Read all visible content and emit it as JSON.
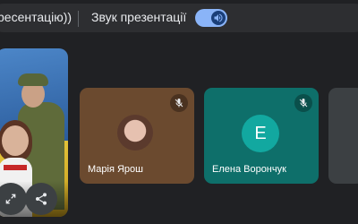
{
  "topbar": {
    "presentation_tab_label": "ресентацію))",
    "presentation_sound_label": "Звук презентації",
    "sound_toggle_state": "on"
  },
  "presentation": {
    "expand_icon": "expand-icon",
    "share_icon": "share-icon"
  },
  "participants": [
    {
      "name": "Марія Ярош",
      "mic": "muted",
      "avatar_type": "photo",
      "tile_color": "#6b4a2f"
    },
    {
      "name": "Елена Ворончук",
      "mic": "muted",
      "avatar_type": "letter",
      "avatar_letter": "Е",
      "tile_color": "#0e6f6a"
    }
  ],
  "colors": {
    "background": "#202124",
    "toggle_accent": "#8ab4f8",
    "avatar_teal": "#12a8a0"
  }
}
